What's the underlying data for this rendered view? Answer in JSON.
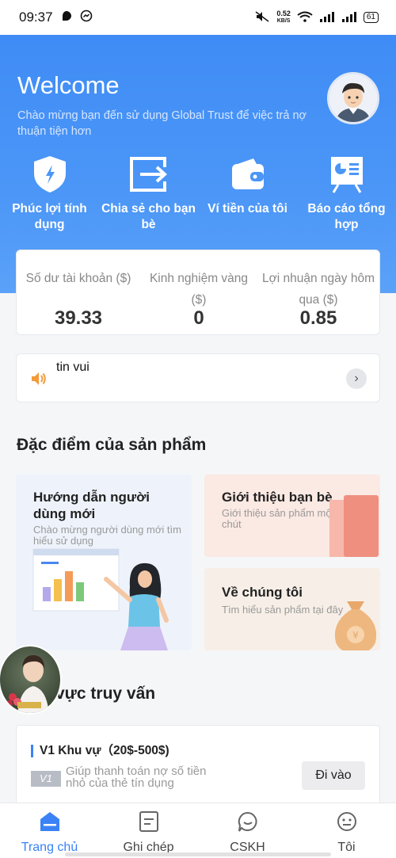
{
  "status_bar": {
    "time": "09:37",
    "net_speed": "0.52",
    "net_unit": "KB/S",
    "battery": "61"
  },
  "hero": {
    "title": "Welcome",
    "subtitle": "Chào mừng bạn đến sử dụng Global Trust để việc trả nợ thuận tiện hơn"
  },
  "quick_actions": [
    {
      "label": "Phúc lợi tính dụng",
      "icon": "shield-lightning-icon"
    },
    {
      "label": "Chia sẻ cho bạn bè",
      "icon": "share-exit-icon"
    },
    {
      "label": "Ví tiền của tôi",
      "icon": "wallet-icon"
    },
    {
      "label": "Báo cáo tổng hợp",
      "icon": "report-board-icon"
    }
  ],
  "stats": [
    {
      "label": "Số dư tài khoản ($)",
      "value": "39.33"
    },
    {
      "label": "Kinh nghiệm vàng ($)",
      "value": "0"
    },
    {
      "label": "Lợi nhuận ngày hôm qua ($)",
      "value": "0.85"
    }
  ],
  "notice": {
    "text": "tin vui",
    "arrow": "›"
  },
  "features": {
    "title": "Đặc điểm của sản phẩm",
    "cards": [
      {
        "title": "Hướng dẫn người dùng mới",
        "subtitle": "Chào mừng người dùng mới tìm hiểu sử dụng"
      },
      {
        "title": "Giới thiệu bạn bè",
        "subtitle": "Giới thiệu sản phẩm một chút"
      },
      {
        "title": "Về chúng tôi",
        "subtitle": "Tìm hiểu sản phẩm tại đây"
      }
    ]
  },
  "query": {
    "title": "vực truy vấn",
    "region": {
      "name": "V1 Khu vự（20$-500$)",
      "badge": "V1",
      "description": "Giúp thanh toán nợ số tiền nhỏ của thẻ tín dụng",
      "button": "Đi vào"
    }
  },
  "tabs": [
    {
      "label": "Trang chủ",
      "icon": "home-icon",
      "active": true
    },
    {
      "label": "Ghi chép",
      "icon": "notes-icon",
      "active": false
    },
    {
      "label": "CSKH",
      "icon": "chat-bubble-icon",
      "active": false
    },
    {
      "label": "Tôi",
      "icon": "profile-face-icon",
      "active": false
    }
  ],
  "colors": {
    "primary": "#3f8cf6",
    "active_tab": "#3b82f6"
  }
}
